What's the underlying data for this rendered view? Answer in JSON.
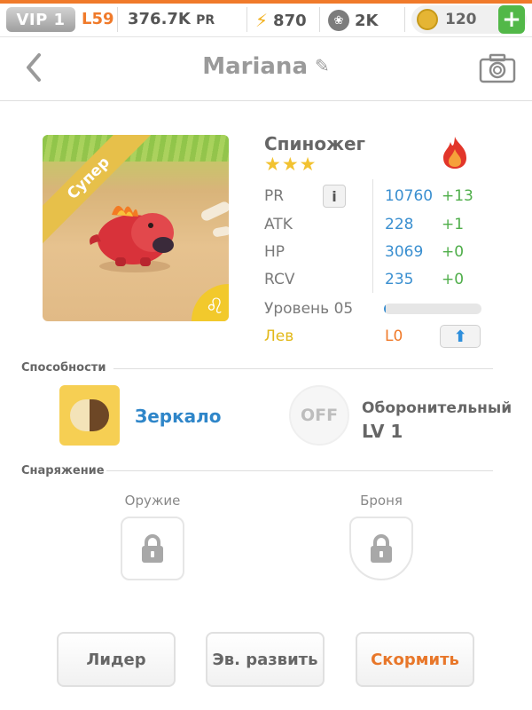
{
  "topbar": {
    "vip": "VIP 1",
    "level": "L59",
    "pr_value": "376.7K",
    "pr_unit": "PR",
    "energy": "870",
    "paw_count": "2K",
    "coins": "120",
    "plus": "+"
  },
  "header": {
    "title": "Mariana"
  },
  "monster": {
    "ribbon": "Супер",
    "name": "Спиножег",
    "stars": "★★★",
    "sign_symbol": "♌",
    "element": "fire"
  },
  "stats": [
    {
      "key": "PR",
      "value": "10760",
      "delta": "+13"
    },
    {
      "key": "ATK",
      "value": "228",
      "delta": "+1"
    },
    {
      "key": "HP",
      "value": "3069",
      "delta": "+0"
    },
    {
      "key": "RCV",
      "value": "235",
      "delta": "+0"
    }
  ],
  "info_button": "i",
  "level_label": "Уровень 05",
  "xp_fraction": 0.02,
  "sign": {
    "label": "Лев",
    "level": "L0",
    "upgrade": "⬆"
  },
  "abilities": {
    "section_label": "Способности",
    "active_name": "Зеркало",
    "passive_toggle": "OFF",
    "passive_name": "Оборонительный",
    "passive_level": "LV 1"
  },
  "equipment": {
    "section_label": "Снаряжение",
    "weapon_label": "Оружие",
    "armor_label": "Броня"
  },
  "buttons": {
    "leader": "Лидер",
    "evolve": "Эв. развить",
    "feed": "Скормить"
  },
  "colors": {
    "accent": "#f07a2a",
    "blue": "#3a8fd0",
    "green": "#4fae4a",
    "gold": "#f2c230"
  }
}
